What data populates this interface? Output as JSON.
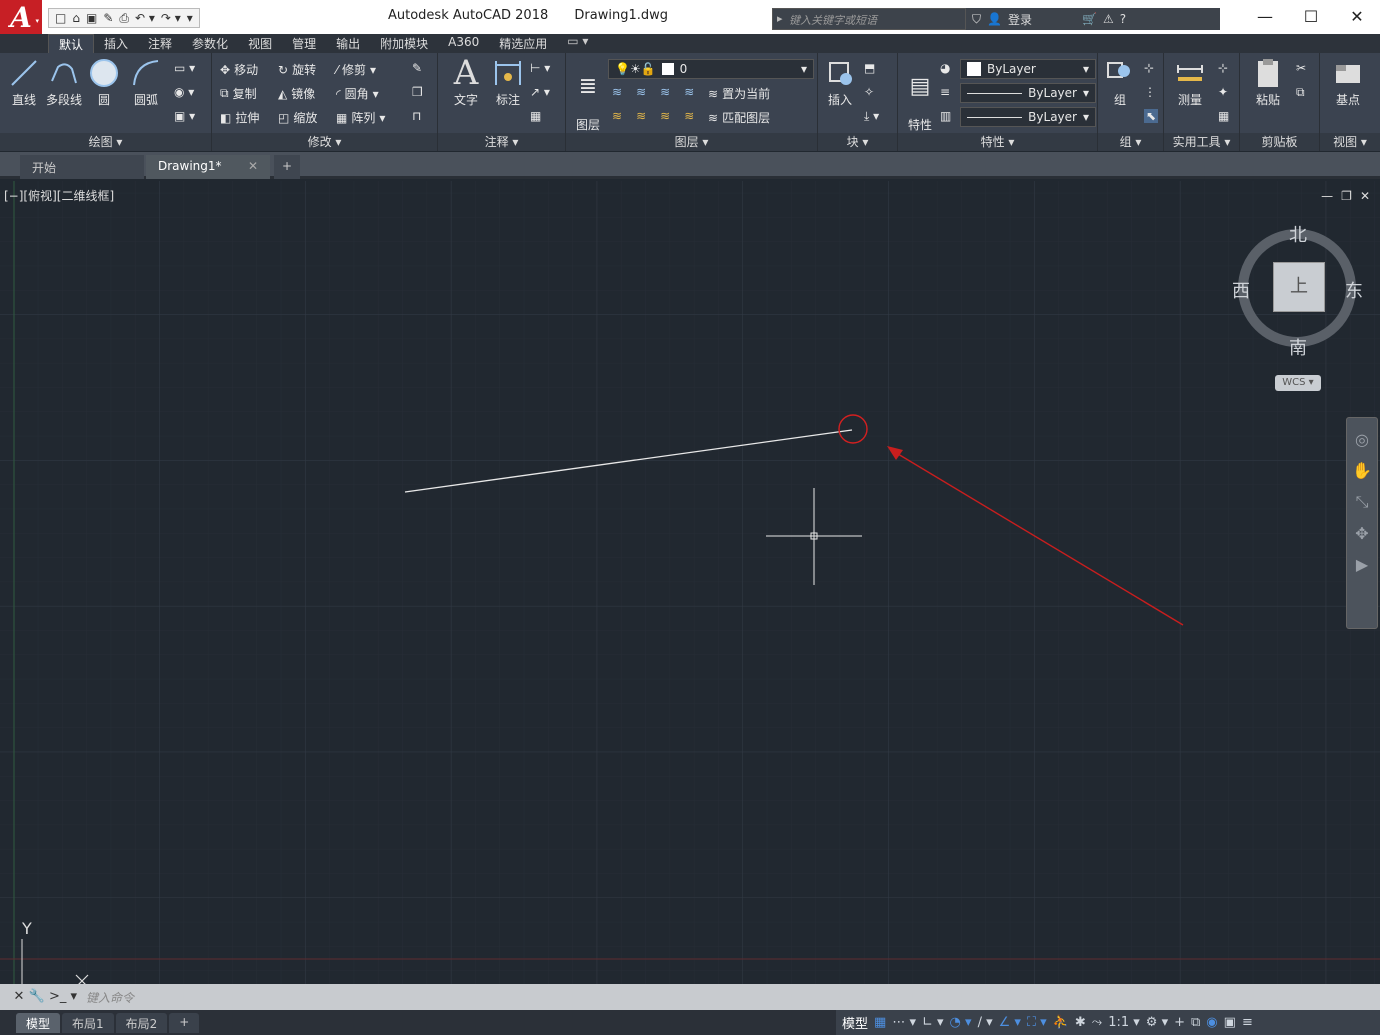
{
  "window": {
    "app_title": "Autodesk AutoCAD 2018",
    "doc_title": "Drawing1.dwg"
  },
  "app_menu": {
    "letter": "A",
    "arrow": "▾"
  },
  "qat": [
    "□",
    "⌂",
    "▣",
    "✎",
    "⎙",
    "↶ ▾",
    "↷ ▾",
    "▾"
  ],
  "search": {
    "placeholder": "键入关键字或短语"
  },
  "user": {
    "login": "登录"
  },
  "window_buttons": {
    "minimize": "—",
    "maximize": "☐",
    "close": "✕"
  },
  "ribbon_tabs": [
    "默认",
    "插入",
    "注释",
    "参数化",
    "视图",
    "管理",
    "输出",
    "附加模块",
    "A360",
    "精选应用"
  ],
  "ribbon_tab_extra": "▭ ▾",
  "panels": {
    "draw": {
      "title": "绘图 ▾",
      "items": [
        "直线",
        "多段线",
        "圆",
        "圆弧"
      ]
    },
    "modify": {
      "title": "修改 ▾",
      "items": [
        "移动",
        "旋转",
        "修剪",
        "复制",
        "镜像",
        "圆角",
        "拉伸",
        "缩放",
        "阵列"
      ]
    },
    "annotation": {
      "title": "注释 ▾",
      "items": [
        "文字",
        "标注"
      ]
    },
    "layers": {
      "title": "图层 ▾",
      "layer_props": "图层\n特性",
      "current_layer": "0",
      "set_current": "置为当前",
      "match_layer": "匹配图层"
    },
    "block": {
      "title": "块 ▾",
      "insert": "插入"
    },
    "properties": {
      "title": "特性 ▾",
      "match": "特性\n匹配",
      "color": "ByLayer",
      "linetype": "ByLayer",
      "lineweight": "ByLayer"
    },
    "groups": {
      "title": "组 ▾",
      "group": "组"
    },
    "utilities": {
      "title": "实用工具 ▾",
      "measure": "测量"
    },
    "clipboard": {
      "title": "剪贴板",
      "paste": "粘贴"
    },
    "view": {
      "title": "视图 ▾",
      "base": "基点"
    }
  },
  "doc_tabs": {
    "start": "开始",
    "drawing": "Drawing1*",
    "close": "✕",
    "new": "+"
  },
  "viewport": {
    "label": "[−][俯视][二维线框]",
    "controls": [
      "—",
      "❐",
      "✕"
    ]
  },
  "viewcube": {
    "north": "北",
    "south": "南",
    "east": "东",
    "west": "西",
    "face": "上",
    "wcs": "WCS ▾"
  },
  "navbar_icons": [
    "◎",
    "✋",
    "⤡",
    "✥",
    "▶"
  ],
  "drawing": {
    "line_color": "#e8e8e8",
    "marker_color": "#d42020",
    "arrow_color": "#c81e1e"
  },
  "ucs": {
    "y": "Y"
  },
  "command": {
    "placeholder": "键入命令",
    "close": "✕",
    "tools": "🔧",
    "prompt": ">_ ▾"
  },
  "layout_tabs": [
    "模型",
    "布局1",
    "布局2",
    "+"
  ],
  "status": {
    "model": "模型",
    "scale": "1:1 ▾",
    "icons": [
      "▦",
      "⋯ ▾",
      "∟ ▾",
      "◔ ▾",
      "∕ ▾",
      "∠ ▾",
      "⛶ ▾",
      "⛹",
      "✱",
      "⤳",
      "⚙ ▾",
      "+",
      "⧉",
      "◉",
      "▣",
      "≡"
    ]
  }
}
